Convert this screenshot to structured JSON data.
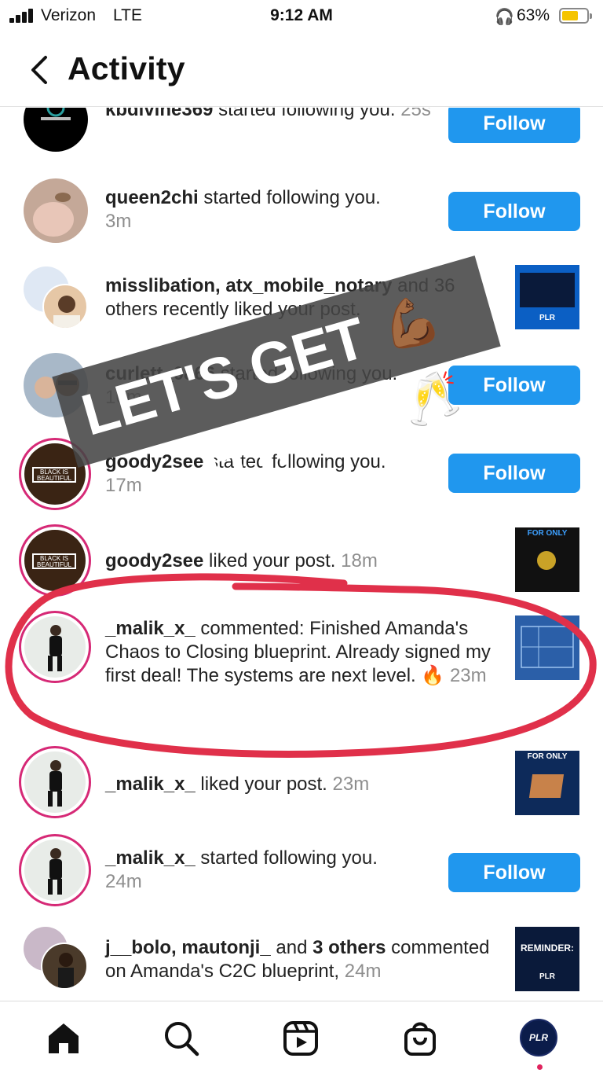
{
  "status_bar": {
    "carrier": "Verizon",
    "network": "LTE",
    "time": "9:12 AM",
    "battery": "63%"
  },
  "header": {
    "title": "Activity"
  },
  "rows": [
    {
      "user": "kbdivine369",
      "action": " started following you. ",
      "time": "25s",
      "button": "Follow"
    },
    {
      "user": "queen2chi",
      "action": " started following you. ",
      "time": "3m",
      "button": "Follow"
    },
    {
      "user": "misslibation, atx_mobile_notary",
      "action": " and 36 others recently liked your post. ",
      "time": ""
    },
    {
      "user": "curlett_0866",
      "action": " started following you. ",
      "time": "16m",
      "button": "Follow"
    },
    {
      "user": "goody2see",
      "action": " started following you. ",
      "time": "17m",
      "button": "Follow"
    },
    {
      "user": "goody2see",
      "action": " liked your post. ",
      "time": "18m"
    },
    {
      "user": "_malik_x_",
      "action": " commented: Finished Amanda's Chaos to Closing blueprint. Already signed my first deal! The systems are next level. 🔥 ",
      "time": "23m"
    },
    {
      "user": "_malik_x_",
      "action": " liked your post. ",
      "time": "23m"
    },
    {
      "user": "_malik_x_",
      "action": " started following you. ",
      "time": "24m",
      "button": "Follow"
    },
    {
      "user": "j__bolo, mautonji_",
      "action": " and ",
      "user2": "3 others",
      "action2": " commented on Amanda's C2C blueprint, ",
      "time": "24m"
    }
  ],
  "thumbnails": {
    "plr_caption": "PLR",
    "for_only": "FOR ONLY",
    "reminder": "REMINDER:"
  },
  "avatar_labels": {
    "black_is": "BLACK IS",
    "beautiful": "BEAUTIFUL",
    "profile": "PLR"
  },
  "sticker": {
    "text": "LET'S GET IT!!",
    "emoji": "💪🏾🥂"
  },
  "tabs": [
    "home",
    "search",
    "reels",
    "shop",
    "profile"
  ],
  "colors": {
    "follow_blue": "#2097ee",
    "ring": "#d62976",
    "circle_red": "#e0304a",
    "time_gray": "#8e8e8e"
  }
}
